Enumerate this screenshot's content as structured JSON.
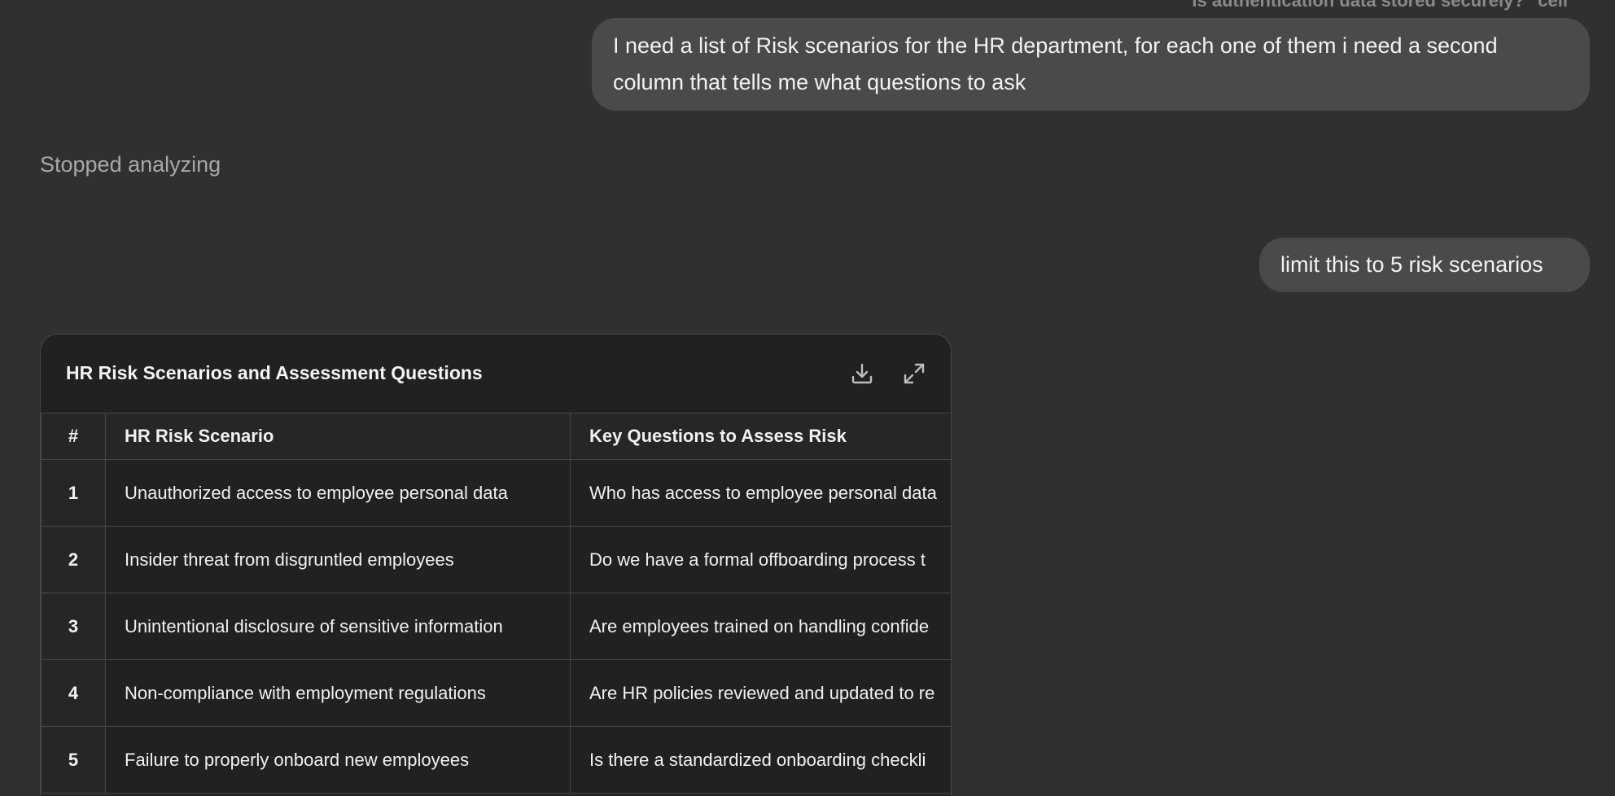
{
  "conversation": {
    "clipped_top_text": "Is authentication data stored securely?\" cell",
    "user_message_1": "I need a list of Risk scenarios for the HR department, for each one of them i need a second column that tells me what questions to ask",
    "status_text": "Stopped analyzing",
    "user_message_2": "limit this to 5 risk scenarios"
  },
  "table_card": {
    "title": "HR Risk Scenarios and Assessment Questions",
    "download_icon": "download-icon",
    "expand_icon": "expand-icon",
    "headers": [
      "#",
      "HR Risk Scenario",
      "Key Questions to Assess Risk"
    ],
    "rows": [
      {
        "num": "1",
        "scenario": "Unauthorized access to employee personal data",
        "question": "Who has access to employee personal data"
      },
      {
        "num": "2",
        "scenario": "Insider threat from disgruntled employees",
        "question": "Do we have a formal offboarding process t"
      },
      {
        "num": "3",
        "scenario": "Unintentional disclosure of sensitive information",
        "question": "Are employees trained on handling confide"
      },
      {
        "num": "4",
        "scenario": "Non-compliance with employment regulations",
        "question": "Are HR policies reviewed and updated to re"
      },
      {
        "num": "5",
        "scenario": "Failure to properly onboard new employees",
        "question": "Is there a standardized onboarding checkli"
      }
    ]
  }
}
